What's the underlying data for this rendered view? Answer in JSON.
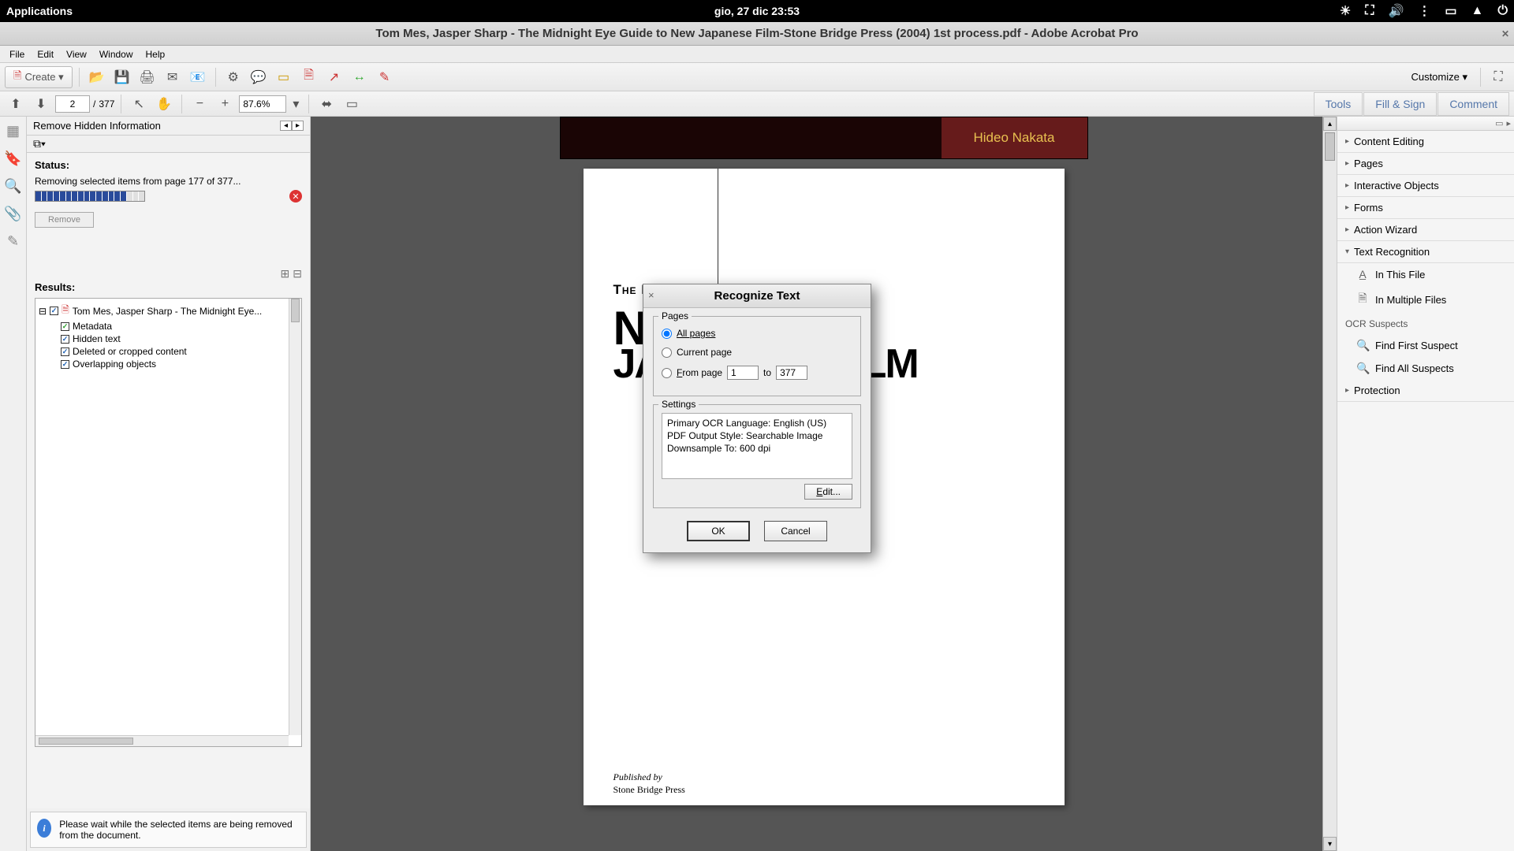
{
  "system": {
    "applications_label": "Applications",
    "datetime": "gio, 27 dic  23:53"
  },
  "window": {
    "title": "Tom Mes, Jasper Sharp - The Midnight Eye Guide to New Japanese Film-Stone Bridge Press (2004) 1st process.pdf - Adobe Acrobat Pro"
  },
  "menu": {
    "file": "File",
    "edit": "Edit",
    "view": "View",
    "window": "Window",
    "help": "Help"
  },
  "toolbar": {
    "create": "Create ▾",
    "customize": "Customize ▾"
  },
  "nav": {
    "current_page": "2",
    "page_sep": "/",
    "total_pages": "377",
    "zoom": "87.6%"
  },
  "right_tabs": {
    "tools": "Tools",
    "fill": "Fill & Sign",
    "comment": "Comment"
  },
  "left_panel": {
    "title": "Remove Hidden Information",
    "status_label": "Status:",
    "status_text": "Removing selected items from page 177 of 377...",
    "remove_btn": "Remove",
    "results_label": "Results:",
    "tree_root": "Tom Mes, Jasper Sharp - The Midnight Eye...",
    "tree_items": [
      "Metadata",
      "Hidden text",
      "Deleted or cropped content",
      "Overlapping objects"
    ],
    "footer_msg": "Please wait while the selected items are being removed from the document."
  },
  "document": {
    "banner_name": "Hideo Nakata",
    "title_small": "The Midnight Eye Guide to",
    "title_big1": "NEW",
    "title_big2": "JAPANESE FILM",
    "pub_label": "Published by",
    "pub_name": "Stone Bridge Press"
  },
  "right_panel": {
    "sections": {
      "content_editing": "Content Editing",
      "pages": "Pages",
      "interactive": "Interactive Objects",
      "forms": "Forms",
      "action_wizard": "Action Wizard",
      "text_recognition": "Text Recognition",
      "protection": "Protection"
    },
    "tr_items": {
      "in_this_file": "In This File",
      "in_multiple": "In Multiple Files",
      "suspects_header": "OCR Suspects",
      "find_first": "Find First Suspect",
      "find_all": "Find All Suspects"
    }
  },
  "modal": {
    "title": "Recognize Text",
    "pages_legend": "Pages",
    "all_pages": "All pages",
    "current_page": "Current page",
    "from_page": "From page",
    "from_value": "1",
    "to_label": "to",
    "to_value": "377",
    "settings_legend": "Settings",
    "settings_line1": "Primary OCR Language: English (US)",
    "settings_line2": "PDF Output Style: Searchable Image",
    "settings_line3": "Downsample To: 600 dpi",
    "edit_btn": "Edit...",
    "ok": "OK",
    "cancel": "Cancel"
  }
}
